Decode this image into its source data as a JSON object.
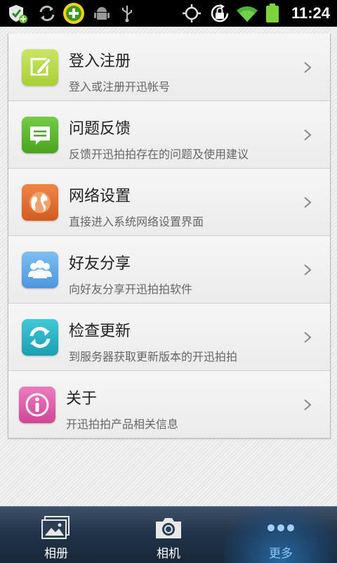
{
  "status_bar": {
    "time": "11:24",
    "icons": [
      "shield-add-icon",
      "sync-icon",
      "plus-badge-icon",
      "android-icon",
      "usb-icon",
      "gps-icon",
      "rotation-lock-icon",
      "wifi-icon",
      "battery-icon"
    ]
  },
  "menu": {
    "items": [
      {
        "title": "登入注册",
        "subtitle": "登入或注册开迅帐号",
        "icon": "edit-icon",
        "color": "#b7d84a"
      },
      {
        "title": "问题反馈",
        "subtitle": "反馈开迅拍拍存在的问题及使用建议",
        "icon": "message-icon",
        "color": "#5cb82d"
      },
      {
        "title": "网络设置",
        "subtitle": "直接进入系统网络设置界面",
        "icon": "globe-icon",
        "color": "#e4702f"
      },
      {
        "title": "好友分享",
        "subtitle": "向好友分享开迅拍拍软件",
        "icon": "friends-icon",
        "color": "#5aa7ea"
      },
      {
        "title": "检查更新",
        "subtitle": "到服务器获取更新版本的开迅拍拍",
        "icon": "refresh-icon",
        "color": "#28b6c8"
      },
      {
        "title": "关于",
        "subtitle": "开迅拍拍产品相关信息",
        "icon": "info-icon",
        "color": "#df5ba8"
      }
    ]
  },
  "bottom_nav": {
    "tabs": [
      {
        "label": "相册",
        "icon": "album-icon",
        "active": false
      },
      {
        "label": "相机",
        "icon": "camera-icon",
        "active": false
      },
      {
        "label": "更多",
        "icon": "more-icon",
        "active": true
      }
    ]
  }
}
